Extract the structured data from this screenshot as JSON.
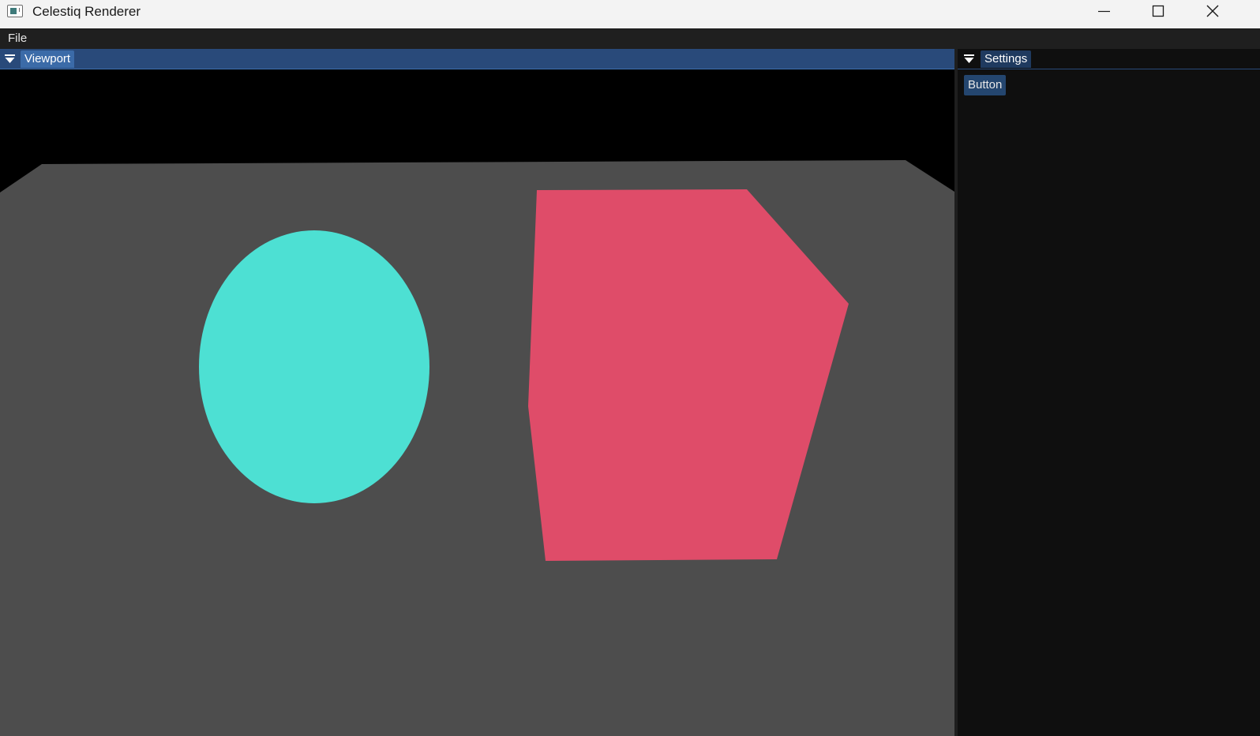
{
  "window": {
    "title": "Celestiq Renderer",
    "controls": [
      "minimize-icon",
      "maximize-icon",
      "close-icon"
    ]
  },
  "menubar": {
    "items": [
      {
        "label": "File"
      }
    ]
  },
  "viewport": {
    "tab_label": "Viewport",
    "scene": {
      "background_color": "#000000",
      "floor_color": "#4d4d4d",
      "sphere_color": "#4de0d3",
      "cube_color": "#df4c69"
    }
  },
  "settings": {
    "tab_label": "Settings",
    "button_label": "Button"
  },
  "colors": {
    "titlebar": "#f3f3f3",
    "menubar": "#1f1f1f",
    "panel_header_active": "#294a7a",
    "tab_active": "#3b6ba8",
    "panel_bg": "#0f0f0f",
    "button": "#24466f"
  }
}
